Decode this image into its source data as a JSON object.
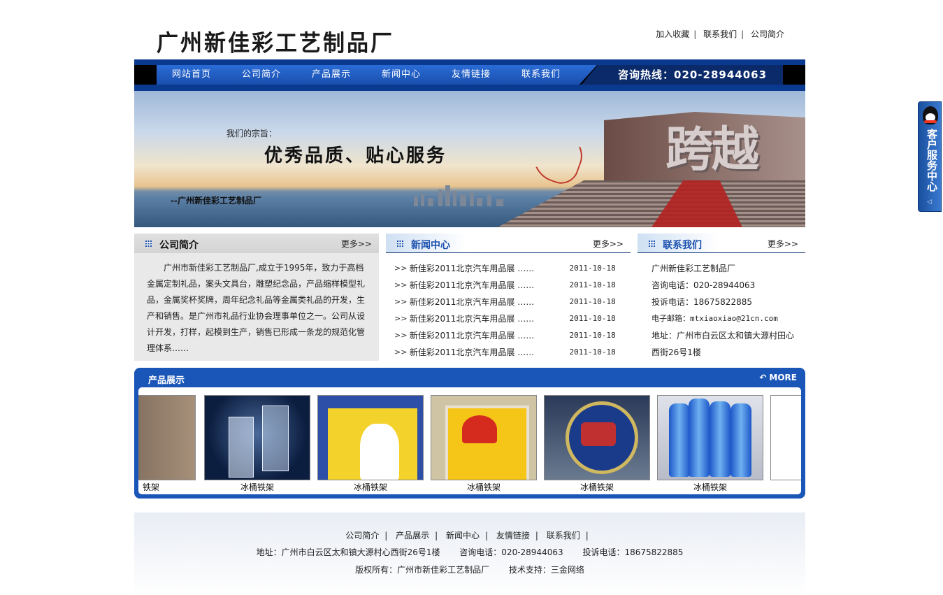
{
  "header": {
    "logo_text": "广州新佳彩工艺制品厂",
    "top_links": [
      "加入收藏",
      "联系我们",
      "公司简介"
    ]
  },
  "nav": {
    "items": [
      "网站首页",
      "公司简介",
      "产品展示",
      "新闻中心",
      "友情链接",
      "联系我们"
    ],
    "hotline": "咨询热线：020-28944063"
  },
  "banner": {
    "motto_label": "我们的宗旨：",
    "motto": "优秀品质、贴心服务",
    "signature": "--广州新佳彩工艺制品厂",
    "big_text": "跨越"
  },
  "about": {
    "title": "公司简介",
    "more": "更多>>",
    "text": "广州市新佳彩工艺制品厂,成立于1995年，致力于高档金属定制礼品，案头文具台，雕塑纪念品，产品缩样模型礼品，金属奖杯奖牌，周年纪念礼品等金属类礼品的开发，生产和销售。是广州市礼品行业协会理事单位之一。公司从设计开发，打样，起模到生产，销售已形成一条龙的规范化管理体系……"
  },
  "news": {
    "title": "新闻中心",
    "more": "更多>>",
    "arrow": ">>",
    "items": [
      {
        "title": "新佳彩2011北京汽车用品展 ……",
        "date": "2011-10-18"
      },
      {
        "title": "新佳彩2011北京汽车用品展 ……",
        "date": "2011-10-18"
      },
      {
        "title": "新佳彩2011北京汽车用品展 ……",
        "date": "2011-10-18"
      },
      {
        "title": "新佳彩2011北京汽车用品展 ……",
        "date": "2011-10-18"
      },
      {
        "title": "新佳彩2011北京汽车用品展 ……",
        "date": "2011-10-18"
      },
      {
        "title": "新佳彩2011北京汽车用品展 ……",
        "date": "2011-10-18"
      }
    ]
  },
  "contact": {
    "title": "联系我们",
    "more": "更多>>",
    "lines": [
      "广州新佳彩工艺制品厂",
      "咨询电话：020-28944063",
      "投诉电话：18675822885",
      "电子邮箱：mtxiaoxiao@21cn.com",
      "地址：广州市白云区太和镇大源村田心西街26号1楼"
    ]
  },
  "products": {
    "title": "产品展示",
    "more": "MORE",
    "items": [
      {
        "caption": "铁架"
      },
      {
        "caption": "冰桶铁架"
      },
      {
        "caption": "冰桶铁架"
      },
      {
        "caption": "冰桶铁架"
      },
      {
        "caption": "冰桶铁架"
      },
      {
        "caption": "冰桶铁架"
      }
    ]
  },
  "footer": {
    "links": [
      "公司简介",
      "产品展示",
      "新闻中心",
      "友情链接",
      "联系我们"
    ],
    "address": "地址：广州市白云区太和镇大源村心西街26号1楼",
    "phone": "咨询电话：020-28944063",
    "complaint": "投诉电话：18675822885",
    "copyright": "版权所有：广州市新佳彩工艺制品厂",
    "support": "技术支持：三金网络"
  },
  "service": {
    "label": "客户服务中心"
  },
  "colors": {
    "brand_blue": "#1a56b7",
    "nav_dark": "#0a3a8f"
  }
}
